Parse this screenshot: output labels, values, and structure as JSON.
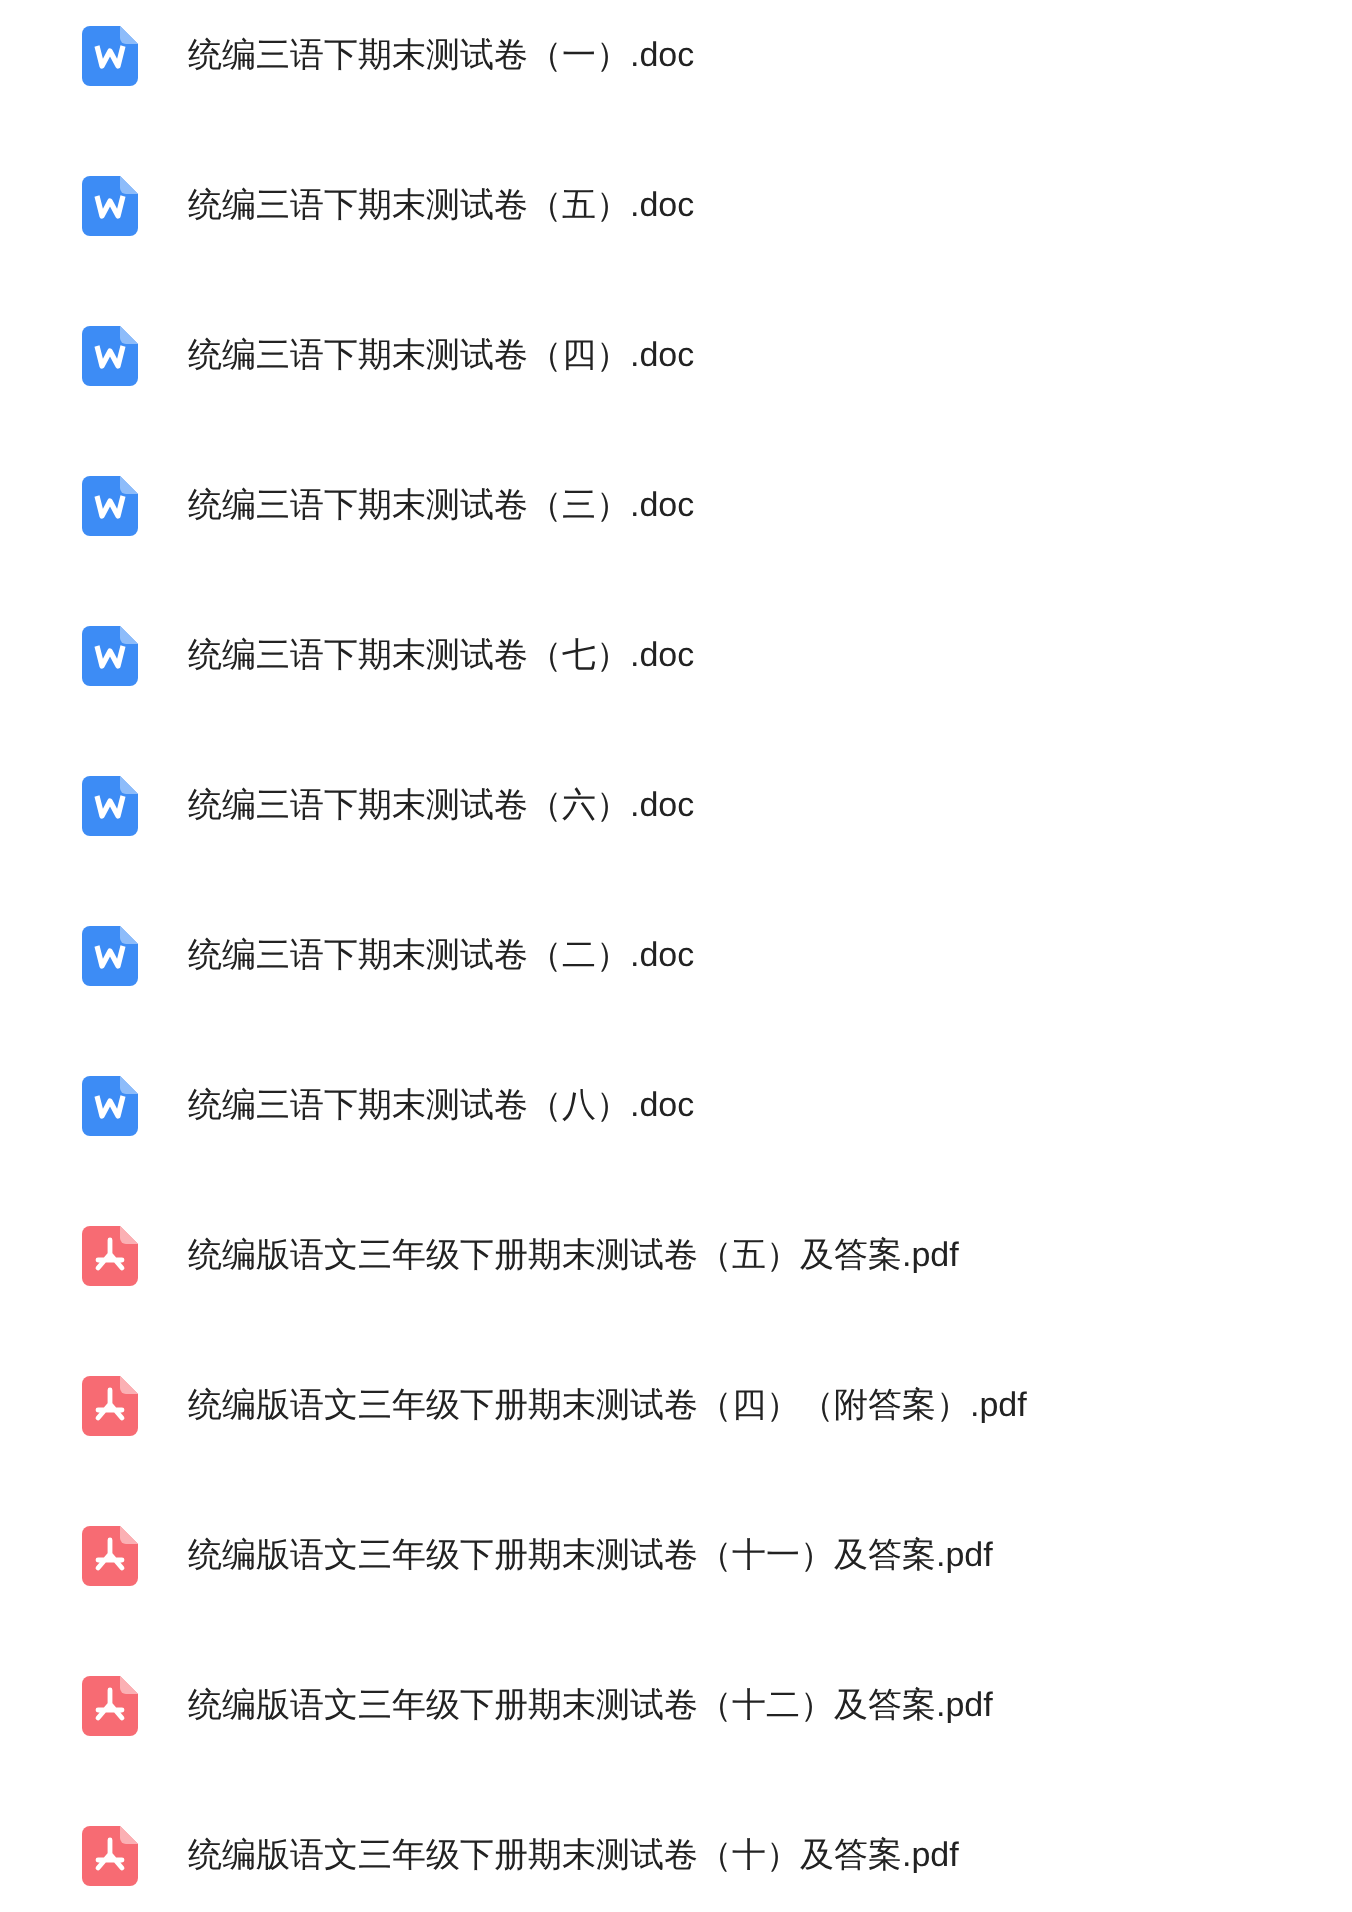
{
  "files": [
    {
      "kind": "doc",
      "name": "统编三语下期末测试卷（一）.doc"
    },
    {
      "kind": "doc",
      "name": "统编三语下期末测试卷（五）.doc"
    },
    {
      "kind": "doc",
      "name": "统编三语下期末测试卷（四）.doc"
    },
    {
      "kind": "doc",
      "name": "统编三语下期末测试卷（三）.doc"
    },
    {
      "kind": "doc",
      "name": "统编三语下期末测试卷（七）.doc"
    },
    {
      "kind": "doc",
      "name": "统编三语下期末测试卷（六）.doc"
    },
    {
      "kind": "doc",
      "name": "统编三语下期末测试卷（二）.doc"
    },
    {
      "kind": "doc",
      "name": "统编三语下期末测试卷（八）.doc"
    },
    {
      "kind": "pdf",
      "name": "统编版语文三年级下册期末测试卷（五）及答案.pdf"
    },
    {
      "kind": "pdf",
      "name": "统编版语文三年级下册期末测试卷（四）（附答案）.pdf"
    },
    {
      "kind": "pdf",
      "name": "统编版语文三年级下册期末测试卷（十一）及答案.pdf"
    },
    {
      "kind": "pdf",
      "name": "统编版语文三年级下册期末测试卷（十二）及答案.pdf"
    },
    {
      "kind": "pdf",
      "name": "统编版语文三年级下册期末测试卷（十）及答案.pdf"
    }
  ]
}
